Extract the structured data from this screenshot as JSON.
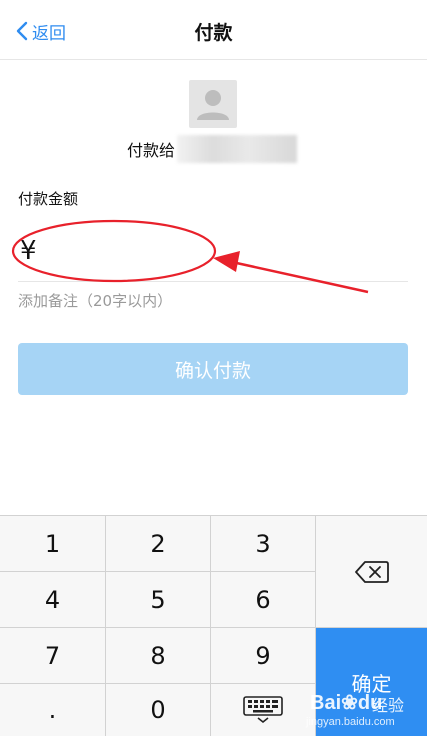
{
  "nav": {
    "back_label": "返回",
    "title": "付款"
  },
  "payee": {
    "prefix": "付款给"
  },
  "amount": {
    "label": "付款金额",
    "currency_symbol": "¥",
    "value": ""
  },
  "remark": {
    "placeholder": "添加备注（20字以内）"
  },
  "confirm_button": {
    "label": "确认付款"
  },
  "keypad": {
    "keys": [
      "1",
      "2",
      "3",
      "4",
      "5",
      "6",
      "7",
      "8",
      "9",
      ".",
      "0"
    ],
    "confirm_label": "确定",
    "delete_icon": "backspace-icon",
    "hide_icon": "keyboard-hide-icon"
  },
  "watermark": {
    "logo": "Bai",
    "logo_tail": "du",
    "jingyan": "经验",
    "url": "jingyan.baidu.com"
  },
  "colors": {
    "accent": "#2f8cf0",
    "confirm_button_disabled": "#a6d4f5",
    "annotation_red": "#e8212b"
  }
}
